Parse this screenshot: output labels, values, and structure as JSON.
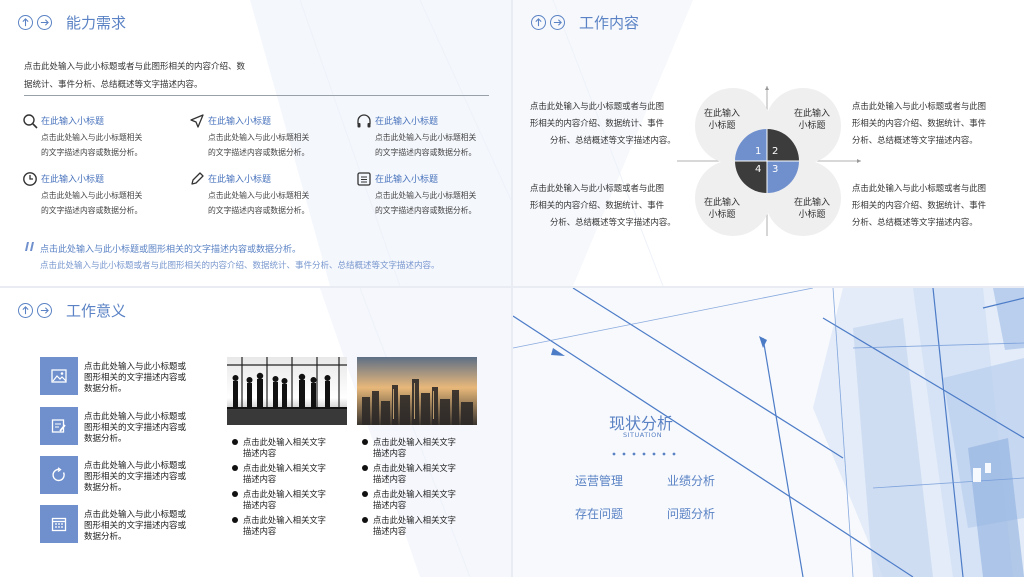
{
  "panel1": {
    "title": "能力需求",
    "intro_line1": "点击此处输入与此小标题或者与此图形相关的内容介绍、数",
    "intro_line2": "据统计、事件分析、总结概述等文字描述内容。",
    "items": [
      {
        "icon": "search-icon",
        "title": "在此输入小标题",
        "desc1": "点击此处输入与此小标题相关",
        "desc2": "的文字描述内容或数据分析。"
      },
      {
        "icon": "send-icon",
        "title": "在此输入小标题",
        "desc1": "点击此处输入与此小标题相关",
        "desc2": "的文字描述内容或数据分析。"
      },
      {
        "icon": "headphones-icon",
        "title": "在此输入小标题",
        "desc1": "点击此处输入与此小标题相关",
        "desc2": "的文字描述内容或数据分析。"
      },
      {
        "icon": "clock-icon",
        "title": "在此输入小标题",
        "desc1": "点击此处输入与此小标题相关",
        "desc2": "的文字描述内容或数据分析。"
      },
      {
        "icon": "pencil-icon",
        "title": "在此输入小标题",
        "desc1": "点击此处输入与此小标题相关",
        "desc2": "的文字描述内容或数据分析。"
      },
      {
        "icon": "document-icon",
        "title": "在此输入小标题",
        "desc1": "点击此处输入与此小标题相关",
        "desc2": "的文字描述内容或数据分析。"
      }
    ],
    "quote_line1": "点击此处输入与此小标题或图形相关的文字描述内容或数据分析。",
    "quote_line2": "点击此处输入与此小标题或者与此图形相关的内容介绍、数据统计、事件分析、总结概述等文字描述内容。"
  },
  "panel2": {
    "title": "工作内容",
    "left_top": [
      "点击此处输入与此小标题或者与此图",
      "形相关的内容介绍、数据统计、事件",
      "分析、总结概述等文字描述内容。"
    ],
    "left_bottom": [
      "点击此处输入与此小标题或者与此图",
      "形相关的内容介绍、数据统计、事件",
      "分析、总结概述等文字描述内容。"
    ],
    "right_top": [
      "点击此处输入与此小标题或者与此图",
      "形相关的内容介绍、数据统计、事件",
      "分析、总结概述等文字描述内容。"
    ],
    "right_bottom": [
      "点击此处输入与此小标题或者与此图",
      "形相关的内容介绍、数据统计、事件",
      "分析、总结概述等文字描述内容。"
    ],
    "circle_labels": [
      {
        "l1": "在此输入",
        "l2": "小标题"
      },
      {
        "l1": "在此输入",
        "l2": "小标题"
      },
      {
        "l1": "在此输入",
        "l2": "小标题"
      },
      {
        "l1": "在此输入",
        "l2": "小标题"
      }
    ],
    "numbers": [
      "1",
      "2",
      "3",
      "4"
    ],
    "colors": {
      "blue": "#6f8fcd",
      "dark": "#3c3c3c"
    }
  },
  "panel3": {
    "title": "工作意义",
    "blocks": [
      {
        "icon": "image-icon",
        "l1": "点击此处输入与此小标题或",
        "l2": "图形相关的文字描述内容或",
        "l3": "数据分析。"
      },
      {
        "icon": "edit-icon",
        "l1": "点击此处输入与此小标题或",
        "l2": "图形相关的文字描述内容或",
        "l3": "数据分析。"
      },
      {
        "icon": "refresh-icon",
        "l1": "点击此处输入与此小标题或",
        "l2": "图形相关的文字描述内容或",
        "l3": "数据分析。"
      },
      {
        "icon": "calendar-icon",
        "l1": "点击此处输入与此小标题或",
        "l2": "图形相关的文字描述内容或",
        "l3": "数据分析。"
      }
    ],
    "bullets_left": [
      {
        "l1": "点击此处输入相关文字",
        "l2": "描述内容"
      },
      {
        "l1": "点击此处输入相关文字",
        "l2": "描述内容"
      },
      {
        "l1": "点击此处输入相关文字",
        "l2": "描述内容"
      },
      {
        "l1": "点击此处输入相关文字",
        "l2": "描述内容"
      }
    ],
    "bullets_right": [
      {
        "l1": "点击此处输入相关文字",
        "l2": "描述内容"
      },
      {
        "l1": "点击此处输入相关文字",
        "l2": "描述内容"
      },
      {
        "l1": "点击此处输入相关文字",
        "l2": "描述内容"
      },
      {
        "l1": "点击此处输入相关文字",
        "l2": "描述内容"
      }
    ]
  },
  "panel4": {
    "title": "现状分析",
    "subtitle": "SITUATION",
    "items": [
      "运营管理",
      "业绩分析",
      "存在问题",
      "问题分析"
    ]
  },
  "accent": "#5a82c4"
}
